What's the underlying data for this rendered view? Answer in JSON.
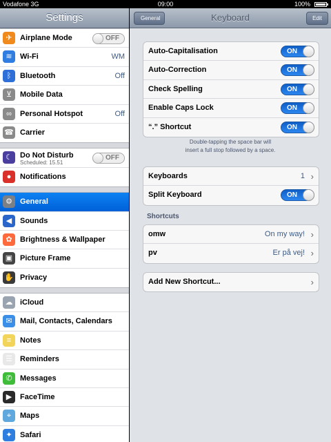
{
  "status_bar": {
    "carrier": "Vodafone 3G",
    "time": "09:00",
    "battery": "100%",
    "battery_level": 1.0
  },
  "left": {
    "title": "Settings",
    "groups": [
      [
        {
          "label": "Airplane Mode",
          "toggle": "OFF",
          "icon": "airplane-icon",
          "color": "#f08a1c"
        },
        {
          "label": "Wi-Fi",
          "value": "WM",
          "icon": "wifi-icon",
          "color": "#2f7de1"
        },
        {
          "label": "Bluetooth",
          "value": "Off",
          "icon": "bluetooth-icon",
          "color": "#2f6fd8"
        },
        {
          "label": "Mobile Data",
          "icon": "antenna-icon",
          "color": "#8a8a8a"
        },
        {
          "label": "Personal Hotspot",
          "value": "Off",
          "icon": "hotspot-icon",
          "color": "#8a8a8a"
        },
        {
          "label": "Carrier",
          "icon": "phone-icon",
          "color": "#8a8a8a"
        }
      ],
      [
        {
          "label": "Do Not Disturb",
          "sub": "Scheduled: 15.51",
          "toggle": "OFF",
          "icon": "moon-icon",
          "color": "#4a3f9e"
        },
        {
          "label": "Notifications",
          "icon": "notifications-icon",
          "color": "#d9302a"
        }
      ],
      [
        {
          "label": "General",
          "icon": "gear-icon",
          "color": "#7b7f86",
          "selected": true
        },
        {
          "label": "Sounds",
          "icon": "speaker-icon",
          "color": "#2a66c9"
        },
        {
          "label": "Brightness & Wallpaper",
          "icon": "flower-icon",
          "color": "#ff6a3d"
        },
        {
          "label": "Picture Frame",
          "icon": "picture-frame-icon",
          "color": "#444"
        },
        {
          "label": "Privacy",
          "icon": "hand-icon",
          "color": "#3a3a3a"
        }
      ],
      [
        {
          "label": "iCloud",
          "icon": "cloud-icon",
          "color": "#9aa4b1"
        },
        {
          "label": "Mail, Contacts, Calendars",
          "icon": "mail-icon",
          "color": "#3b8fe6"
        },
        {
          "label": "Notes",
          "icon": "notes-icon",
          "color": "#f2d45b"
        },
        {
          "label": "Reminders",
          "icon": "reminders-icon",
          "color": "#e8e8e8"
        },
        {
          "label": "Messages",
          "icon": "messages-icon",
          "color": "#3fbd3a"
        },
        {
          "label": "FaceTime",
          "icon": "facetime-icon",
          "color": "#2a2a2a"
        },
        {
          "label": "Maps",
          "icon": "maps-icon",
          "color": "#5fa8de"
        },
        {
          "label": "Safari",
          "icon": "compass-icon",
          "color": "#2e7ee0"
        }
      ]
    ]
  },
  "right": {
    "back": "General",
    "title": "Keyboard",
    "edit": "Edit",
    "toggles": [
      {
        "label": "Auto-Capitalisation",
        "state": "ON"
      },
      {
        "label": "Auto-Correction",
        "state": "ON"
      },
      {
        "label": "Check Spelling",
        "state": "ON"
      },
      {
        "label": "Enable Caps Lock",
        "state": "ON"
      },
      {
        "label": "“.” Shortcut",
        "state": "ON"
      }
    ],
    "footnote_line1": "Double-tapping the space bar will",
    "footnote_line2": "insert a full stop followed by a space.",
    "keyboards_label": "Keyboards",
    "keyboards_count": "1",
    "split_label": "Split Keyboard",
    "split_state": "ON",
    "shortcuts_title": "Shortcuts",
    "shortcuts": [
      {
        "label": "omw",
        "value": "On my way!"
      },
      {
        "label": "pv",
        "value": "Er på vej!"
      }
    ],
    "add_shortcut": "Add New Shortcut..."
  },
  "icons": {
    "chevron": "›"
  }
}
